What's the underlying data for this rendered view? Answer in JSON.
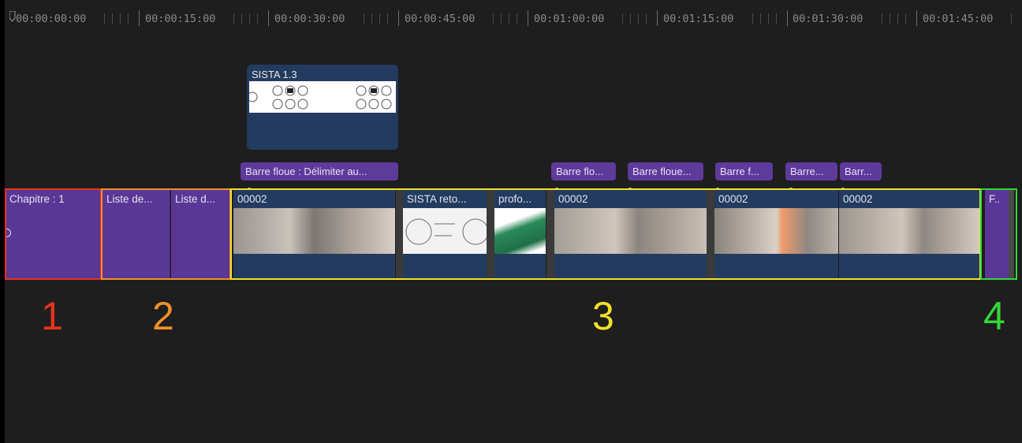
{
  "timeline": {
    "timecodes": [
      "00:00:00:00",
      "00:00:15:00",
      "00:00:30:00",
      "00:00:45:00",
      "00:01:00:00",
      "00:01:15:00",
      "00:01:30:00",
      "00:01:45:00"
    ]
  },
  "connected_title": {
    "label": "SISTA 1.3"
  },
  "effects": [
    {
      "label": "Barre floue : Délimiter au..."
    },
    {
      "label": "Barre flo..."
    },
    {
      "label": "Barre floue..."
    },
    {
      "label": "Barre f..."
    },
    {
      "label": "Barre..."
    },
    {
      "label": "Barr..."
    }
  ],
  "primary": {
    "chapter": {
      "label": "Chapitre : 1"
    },
    "lists": [
      {
        "label": "Liste de..."
      },
      {
        "label": "Liste d..."
      }
    ],
    "clips": [
      {
        "label": "00002"
      },
      {
        "label": "SISTA reto..."
      },
      {
        "label": "profo..."
      },
      {
        "label": "00002"
      },
      {
        "label": "00002"
      },
      {
        "label": "00002"
      }
    ],
    "end": {
      "label": "F.."
    }
  },
  "groups": [
    {
      "number": "1",
      "color": "#e8321e"
    },
    {
      "number": "2",
      "color": "#f0902a"
    },
    {
      "number": "3",
      "color": "#f0e12a"
    },
    {
      "number": "4",
      "color": "#37d53a"
    }
  ]
}
